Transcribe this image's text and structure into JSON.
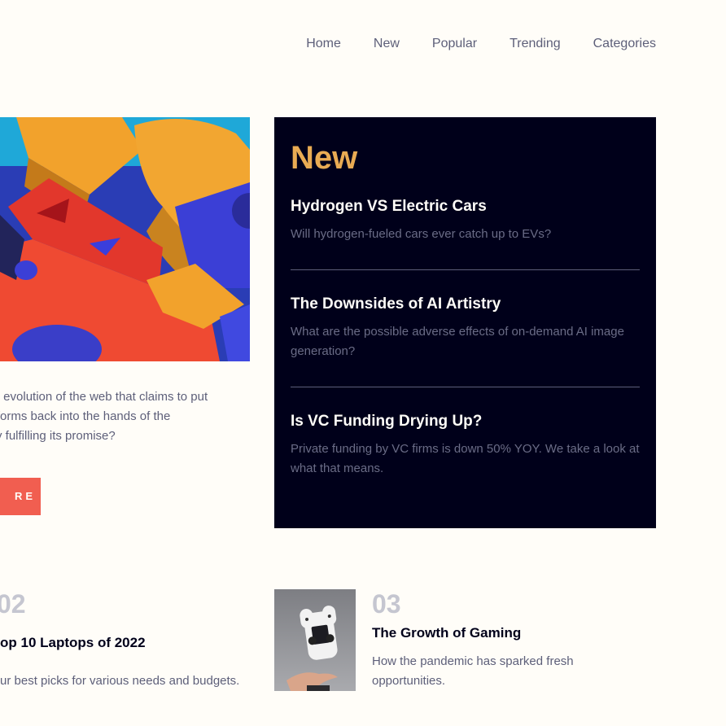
{
  "nav": {
    "items": [
      {
        "label": "Home"
      },
      {
        "label": "New"
      },
      {
        "label": "Popular"
      },
      {
        "label": "Trending"
      },
      {
        "label": "Categories"
      }
    ]
  },
  "hero": {
    "text_lines": [
      "ext evolution of the web that claims to put",
      "latforms back into the hands of the",
      "ally fulfilling its promise?"
    ],
    "button_label": "RE"
  },
  "new_panel": {
    "title": "New",
    "items": [
      {
        "title": "Hydrogen VS Electric Cars",
        "desc": "Will hydrogen-fueled cars ever catch up to EVs?"
      },
      {
        "title": "The Downsides of AI Artistry",
        "desc": "What are the possible adverse effects of on-demand AI image generation?"
      },
      {
        "title": "Is VC Funding Drying Up?",
        "desc": "Private funding by VC firms is down 50% YOY. We take a look at what that means."
      }
    ]
  },
  "cards": [
    {
      "number": "02",
      "title": "op 10 Laptops of 2022",
      "desc": "ur best picks for various needs and budgets."
    },
    {
      "number": "03",
      "title": "The Growth of Gaming",
      "desc": "How the pandemic has sparked fresh opportunities."
    }
  ],
  "colors": {
    "background": "#fffdf8",
    "panel": "#00001a",
    "accent_orange": "#e9ab53",
    "accent_red": "#f15e50",
    "muted": "#5d5f79"
  }
}
